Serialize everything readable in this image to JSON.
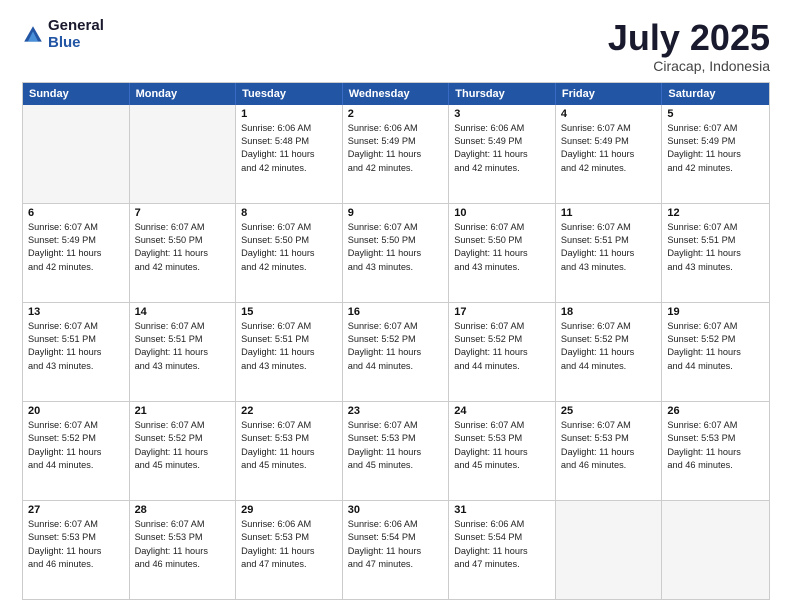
{
  "logo": {
    "general": "General",
    "blue": "Blue"
  },
  "header": {
    "month": "July 2025",
    "location": "Ciracap, Indonesia"
  },
  "weekdays": [
    "Sunday",
    "Monday",
    "Tuesday",
    "Wednesday",
    "Thursday",
    "Friday",
    "Saturday"
  ],
  "rows": [
    [
      {
        "day": "",
        "lines": [],
        "empty": true
      },
      {
        "day": "",
        "lines": [],
        "empty": true
      },
      {
        "day": "1",
        "lines": [
          "Sunrise: 6:06 AM",
          "Sunset: 5:48 PM",
          "Daylight: 11 hours",
          "and 42 minutes."
        ]
      },
      {
        "day": "2",
        "lines": [
          "Sunrise: 6:06 AM",
          "Sunset: 5:49 PM",
          "Daylight: 11 hours",
          "and 42 minutes."
        ]
      },
      {
        "day": "3",
        "lines": [
          "Sunrise: 6:06 AM",
          "Sunset: 5:49 PM",
          "Daylight: 11 hours",
          "and 42 minutes."
        ]
      },
      {
        "day": "4",
        "lines": [
          "Sunrise: 6:07 AM",
          "Sunset: 5:49 PM",
          "Daylight: 11 hours",
          "and 42 minutes."
        ]
      },
      {
        "day": "5",
        "lines": [
          "Sunrise: 6:07 AM",
          "Sunset: 5:49 PM",
          "Daylight: 11 hours",
          "and 42 minutes."
        ]
      }
    ],
    [
      {
        "day": "6",
        "lines": [
          "Sunrise: 6:07 AM",
          "Sunset: 5:49 PM",
          "Daylight: 11 hours",
          "and 42 minutes."
        ]
      },
      {
        "day": "7",
        "lines": [
          "Sunrise: 6:07 AM",
          "Sunset: 5:50 PM",
          "Daylight: 11 hours",
          "and 42 minutes."
        ]
      },
      {
        "day": "8",
        "lines": [
          "Sunrise: 6:07 AM",
          "Sunset: 5:50 PM",
          "Daylight: 11 hours",
          "and 42 minutes."
        ]
      },
      {
        "day": "9",
        "lines": [
          "Sunrise: 6:07 AM",
          "Sunset: 5:50 PM",
          "Daylight: 11 hours",
          "and 43 minutes."
        ]
      },
      {
        "day": "10",
        "lines": [
          "Sunrise: 6:07 AM",
          "Sunset: 5:50 PM",
          "Daylight: 11 hours",
          "and 43 minutes."
        ]
      },
      {
        "day": "11",
        "lines": [
          "Sunrise: 6:07 AM",
          "Sunset: 5:51 PM",
          "Daylight: 11 hours",
          "and 43 minutes."
        ]
      },
      {
        "day": "12",
        "lines": [
          "Sunrise: 6:07 AM",
          "Sunset: 5:51 PM",
          "Daylight: 11 hours",
          "and 43 minutes."
        ]
      }
    ],
    [
      {
        "day": "13",
        "lines": [
          "Sunrise: 6:07 AM",
          "Sunset: 5:51 PM",
          "Daylight: 11 hours",
          "and 43 minutes."
        ]
      },
      {
        "day": "14",
        "lines": [
          "Sunrise: 6:07 AM",
          "Sunset: 5:51 PM",
          "Daylight: 11 hours",
          "and 43 minutes."
        ]
      },
      {
        "day": "15",
        "lines": [
          "Sunrise: 6:07 AM",
          "Sunset: 5:51 PM",
          "Daylight: 11 hours",
          "and 43 minutes."
        ]
      },
      {
        "day": "16",
        "lines": [
          "Sunrise: 6:07 AM",
          "Sunset: 5:52 PM",
          "Daylight: 11 hours",
          "and 44 minutes."
        ]
      },
      {
        "day": "17",
        "lines": [
          "Sunrise: 6:07 AM",
          "Sunset: 5:52 PM",
          "Daylight: 11 hours",
          "and 44 minutes."
        ]
      },
      {
        "day": "18",
        "lines": [
          "Sunrise: 6:07 AM",
          "Sunset: 5:52 PM",
          "Daylight: 11 hours",
          "and 44 minutes."
        ]
      },
      {
        "day": "19",
        "lines": [
          "Sunrise: 6:07 AM",
          "Sunset: 5:52 PM",
          "Daylight: 11 hours",
          "and 44 minutes."
        ]
      }
    ],
    [
      {
        "day": "20",
        "lines": [
          "Sunrise: 6:07 AM",
          "Sunset: 5:52 PM",
          "Daylight: 11 hours",
          "and 44 minutes."
        ]
      },
      {
        "day": "21",
        "lines": [
          "Sunrise: 6:07 AM",
          "Sunset: 5:52 PM",
          "Daylight: 11 hours",
          "and 45 minutes."
        ]
      },
      {
        "day": "22",
        "lines": [
          "Sunrise: 6:07 AM",
          "Sunset: 5:53 PM",
          "Daylight: 11 hours",
          "and 45 minutes."
        ]
      },
      {
        "day": "23",
        "lines": [
          "Sunrise: 6:07 AM",
          "Sunset: 5:53 PM",
          "Daylight: 11 hours",
          "and 45 minutes."
        ]
      },
      {
        "day": "24",
        "lines": [
          "Sunrise: 6:07 AM",
          "Sunset: 5:53 PM",
          "Daylight: 11 hours",
          "and 45 minutes."
        ]
      },
      {
        "day": "25",
        "lines": [
          "Sunrise: 6:07 AM",
          "Sunset: 5:53 PM",
          "Daylight: 11 hours",
          "and 46 minutes."
        ]
      },
      {
        "day": "26",
        "lines": [
          "Sunrise: 6:07 AM",
          "Sunset: 5:53 PM",
          "Daylight: 11 hours",
          "and 46 minutes."
        ]
      }
    ],
    [
      {
        "day": "27",
        "lines": [
          "Sunrise: 6:07 AM",
          "Sunset: 5:53 PM",
          "Daylight: 11 hours",
          "and 46 minutes."
        ]
      },
      {
        "day": "28",
        "lines": [
          "Sunrise: 6:07 AM",
          "Sunset: 5:53 PM",
          "Daylight: 11 hours",
          "and 46 minutes."
        ]
      },
      {
        "day": "29",
        "lines": [
          "Sunrise: 6:06 AM",
          "Sunset: 5:53 PM",
          "Daylight: 11 hours",
          "and 47 minutes."
        ]
      },
      {
        "day": "30",
        "lines": [
          "Sunrise: 6:06 AM",
          "Sunset: 5:54 PM",
          "Daylight: 11 hours",
          "and 47 minutes."
        ]
      },
      {
        "day": "31",
        "lines": [
          "Sunrise: 6:06 AM",
          "Sunset: 5:54 PM",
          "Daylight: 11 hours",
          "and 47 minutes."
        ]
      },
      {
        "day": "",
        "lines": [],
        "empty": true
      },
      {
        "day": "",
        "lines": [],
        "empty": true
      }
    ]
  ]
}
